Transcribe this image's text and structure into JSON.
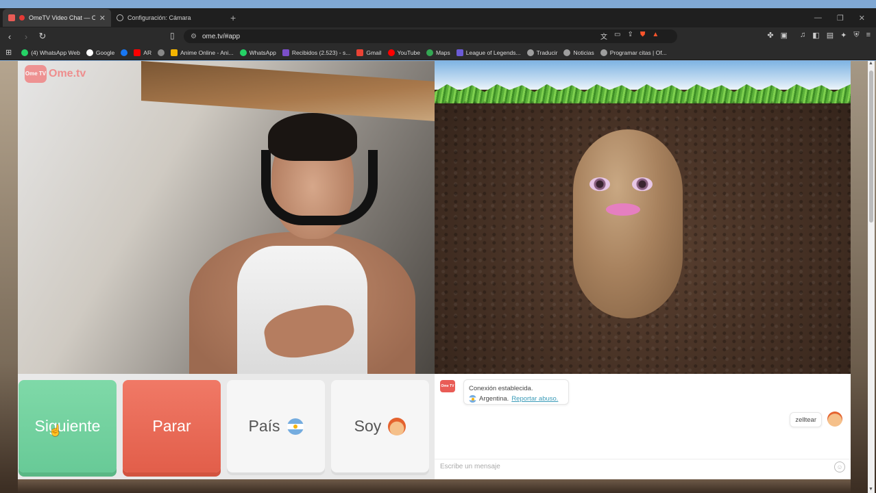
{
  "browser": {
    "tabs": [
      {
        "title": "OmeTV Video Chat — Omeg",
        "active": true
      },
      {
        "title": "Configuración: Cámara",
        "active": false
      }
    ],
    "url": "ome.tv/#app",
    "bookmarks": [
      {
        "label": "(4) WhatsApp Web",
        "color": "#25d366"
      },
      {
        "label": "Google",
        "color": "#ffffff"
      },
      {
        "label": "",
        "color": "#1877f2"
      },
      {
        "label": "AR",
        "color": "#ff0000"
      },
      {
        "label": "",
        "color": "#888888"
      },
      {
        "label": "Anime Online - Ani...",
        "color": "#f4b400"
      },
      {
        "label": "WhatsApp",
        "color": "#25d366"
      },
      {
        "label": "Recibidos (2.523) - s...",
        "color": "#7b4fc9"
      },
      {
        "label": "Gmail",
        "color": "#ea4335"
      },
      {
        "label": "YouTube",
        "color": "#ff0000"
      },
      {
        "label": "Maps",
        "color": "#34a853"
      },
      {
        "label": "League of Legends...",
        "color": "#6b5bd6"
      },
      {
        "label": "Traducir",
        "color": "#9e9e9e"
      },
      {
        "label": "Noticias",
        "color": "#9e9e9e"
      },
      {
        "label": "Programar citas | Of...",
        "color": "#9e9e9e"
      }
    ]
  },
  "app": {
    "logo_badge": "Ome TV",
    "logo_text": "Ome.tv",
    "buttons": {
      "next": "Siguiente",
      "stop": "Parar",
      "country": "País",
      "gender": "Soy"
    },
    "chat": {
      "system_icon": "Ome TV",
      "connection_text": "Conexión establecida.",
      "country_text": "Argentina.",
      "report_link": "Reportar abuso.",
      "my_message": "zelltear",
      "input_placeholder": "Escribe un mensaje"
    }
  },
  "colors": {
    "next": "#68ca97",
    "stop": "#e25e4a",
    "accent_link": "#3a9bb8"
  }
}
